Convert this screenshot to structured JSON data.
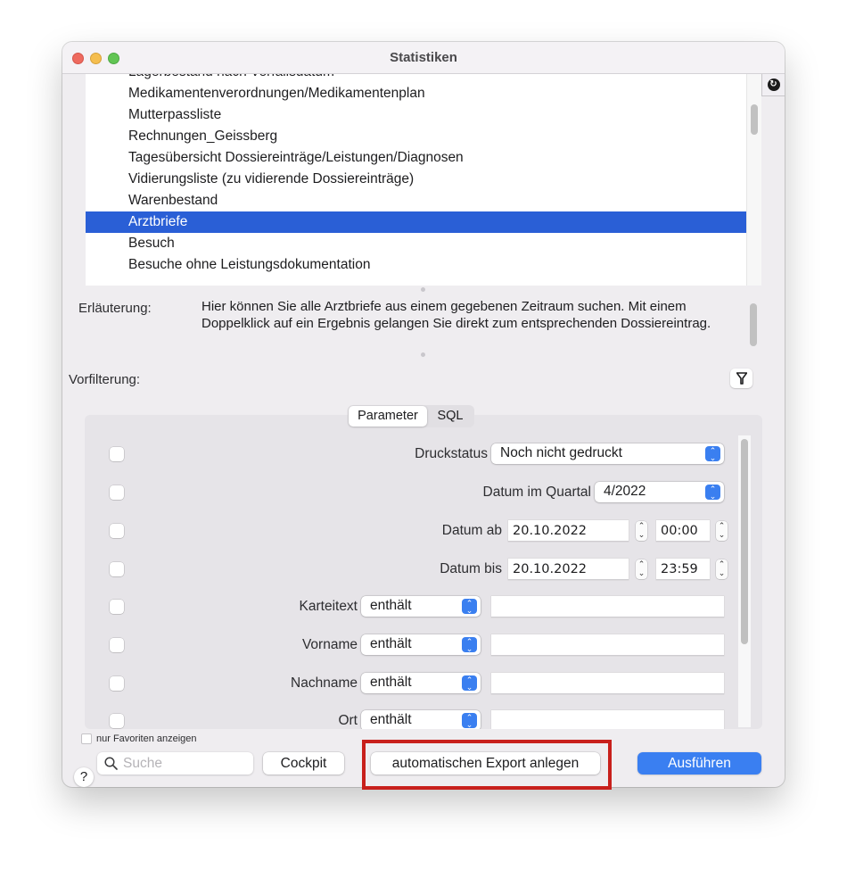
{
  "window": {
    "title": "Statistiken",
    "traffic_lights": [
      "close",
      "minimize",
      "zoom"
    ]
  },
  "report_list": {
    "items": [
      {
        "label": "Lagerbestand nach Verfallsdatum",
        "selected": false,
        "partial": true
      },
      {
        "label": "Medikamentenverordnungen/Medikamentenplan",
        "selected": false
      },
      {
        "label": "Mutterpassliste",
        "selected": false
      },
      {
        "label": "Rechnungen_Geissberg",
        "selected": false
      },
      {
        "label": "Tagesübersicht Dossiereinträge/Leistungen/Diagnosen",
        "selected": false
      },
      {
        "label": "Vidierungsliste (zu vidierende Dossiereinträge)",
        "selected": false
      },
      {
        "label": "Warenbestand",
        "selected": false
      },
      {
        "label": "Arztbriefe",
        "selected": true
      },
      {
        "label": "Besuch",
        "selected": false
      },
      {
        "label": "Besuche ohne Leistungsdokumentation",
        "selected": false
      }
    ],
    "refresh_icon": "refresh-icon"
  },
  "explanation": {
    "label": "Erläuterung:",
    "text": "Hier können Sie alle Arztbriefe aus einem gegebenen Zeitraum suchen. Mit einem Doppelklick auf ein Ergebnis gelangen Sie direkt zum entsprechenden Dossiereintrag."
  },
  "prefilter": {
    "label": "Vorfilterung:",
    "icon": "filter-icon"
  },
  "tabs": {
    "parameter": "Parameter",
    "sql": "SQL",
    "active": "Parameter"
  },
  "parameters": {
    "druckstatus": {
      "label": "Druckstatus",
      "value": "Noch nicht gedruckt",
      "checked": false
    },
    "quartal": {
      "label": "Datum im Quartal",
      "value": "4/2022",
      "checked": false
    },
    "datum_ab": {
      "label": "Datum ab",
      "date": "20.10.2022",
      "time": "00:00",
      "checked": false
    },
    "datum_bis": {
      "label": "Datum bis",
      "date": "20.10.2022",
      "time": "23:59",
      "checked": false
    },
    "karteitext": {
      "label": "Karteitext",
      "operator": "enthält",
      "value": "",
      "checked": false
    },
    "vorname": {
      "label": "Vorname",
      "operator": "enthält",
      "value": "",
      "checked": false
    },
    "nachname": {
      "label": "Nachname",
      "operator": "enthält",
      "value": "",
      "checked": false
    },
    "ort": {
      "label": "Ort",
      "operator": "enthält",
      "value": "",
      "checked": false
    }
  },
  "footer": {
    "favorites_label": "nur Favoriten anzeigen",
    "favorites_checked": false,
    "help_label": "?",
    "search_placeholder": "Suche",
    "search_value": "",
    "cockpit_label": "Cockpit",
    "export_label": "automatischen Export anlegen",
    "run_label": "Ausführen"
  },
  "colors": {
    "selection": "#2a5fd6",
    "primary_button": "#3a7ff1",
    "highlight_box": "#c8201c"
  }
}
